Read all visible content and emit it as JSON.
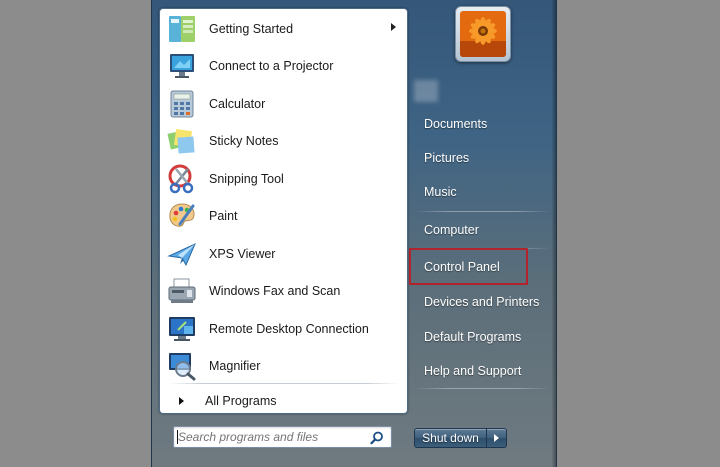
{
  "programs": [
    {
      "label": "Getting Started",
      "icon": "getting-started-icon",
      "has_submenu": true
    },
    {
      "label": "Connect to a Projector",
      "icon": "projector-icon"
    },
    {
      "label": "Calculator",
      "icon": "calculator-icon"
    },
    {
      "label": "Sticky Notes",
      "icon": "sticky-notes-icon"
    },
    {
      "label": "Snipping Tool",
      "icon": "snipping-tool-icon"
    },
    {
      "label": "Paint",
      "icon": "paint-palette-icon"
    },
    {
      "label": "XPS Viewer",
      "icon": "xps-viewer-icon"
    },
    {
      "label": "Windows Fax and Scan",
      "icon": "fax-scan-icon"
    },
    {
      "label": "Remote Desktop Connection",
      "icon": "remote-desktop-icon"
    },
    {
      "label": "Magnifier",
      "icon": "magnifier-icon"
    }
  ],
  "all_programs_label": "All Programs",
  "search": {
    "placeholder": "Search programs and files",
    "icon": "search-icon"
  },
  "user": {
    "picture": "user-picture-flower"
  },
  "right_items": [
    {
      "label": "Documents"
    },
    {
      "label": "Pictures"
    },
    {
      "label": "Music"
    },
    {
      "label": "Computer"
    },
    {
      "label": "Control Panel",
      "highlighted": true
    },
    {
      "label": "Devices and Printers"
    },
    {
      "label": "Default Programs"
    },
    {
      "label": "Help and Support"
    }
  ],
  "shutdown": {
    "label": "Shut down"
  },
  "colors": {
    "highlight_border": "#b3232c",
    "menu_glass": "#3f6484",
    "left_pane": "#ffffff"
  }
}
